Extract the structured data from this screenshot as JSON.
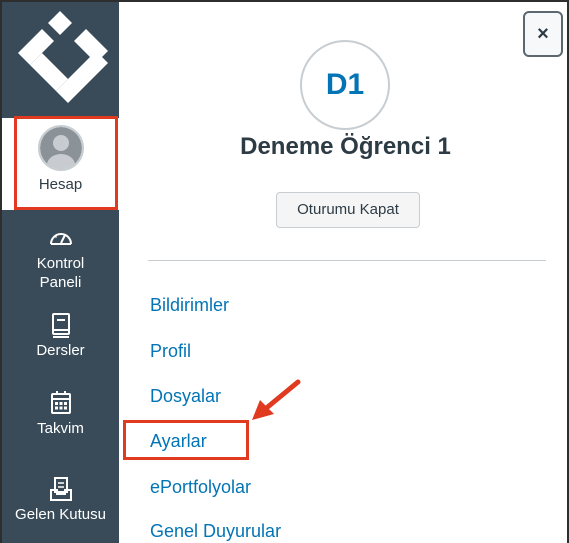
{
  "sidebar": {
    "account": {
      "label": "Hesap"
    },
    "items": [
      {
        "name": "dashboard",
        "label_line1": "Kontrol",
        "label_line2": "Paneli",
        "icon": "speedometer-icon"
      },
      {
        "name": "courses",
        "label": "Dersler",
        "icon": "book-icon"
      },
      {
        "name": "calendar",
        "label": "Takvim",
        "icon": "calendar-icon"
      },
      {
        "name": "inbox",
        "label": "Gelen Kutusu",
        "icon": "inbox-icon"
      }
    ]
  },
  "tray": {
    "close_label": "×",
    "avatar_initials": "D1",
    "user_name": "Deneme Öğrenci 1",
    "logout_label": "Oturumu Kapat",
    "links": [
      {
        "label": "Bildirimler"
      },
      {
        "label": "Profil"
      },
      {
        "label": "Dosyalar"
      },
      {
        "label": "Ayarlar"
      },
      {
        "label": "ePortfolyolar"
      },
      {
        "label": "Genel Duyurular"
      }
    ]
  },
  "colors": {
    "sidebar_bg": "#394b58",
    "link": "#0374b5",
    "highlight": "#e03a20"
  }
}
